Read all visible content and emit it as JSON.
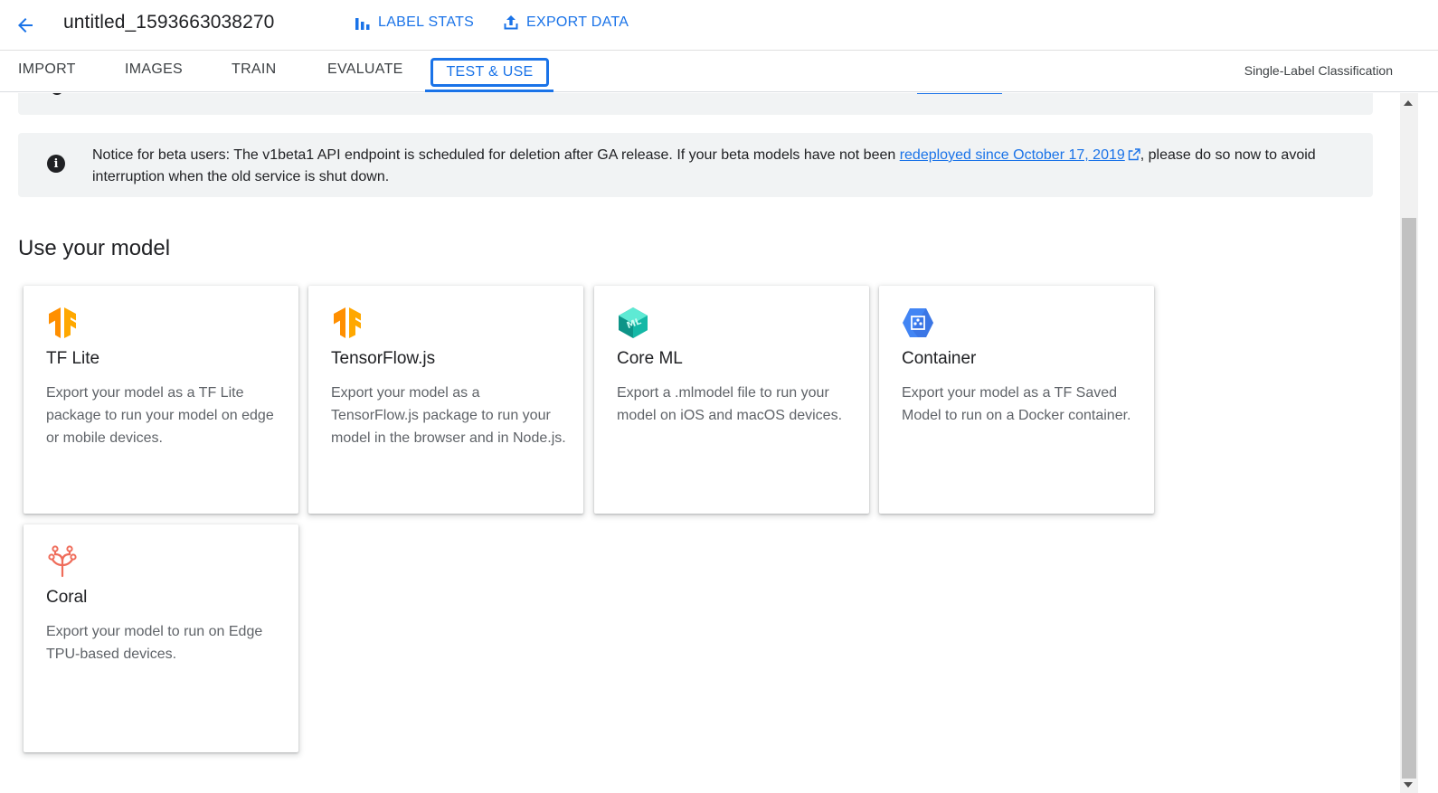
{
  "header": {
    "title": "untitled_1593663038270",
    "label_stats": "LABEL STATS",
    "export_data": "EXPORT DATA"
  },
  "tabs": [
    {
      "label": "IMPORT"
    },
    {
      "label": "IMAGES"
    },
    {
      "label": "TRAIN"
    },
    {
      "label": "EVALUATE"
    },
    {
      "label": "TEST & USE",
      "active": true
    }
  ],
  "model_type": "Single-Label Classification",
  "notice": {
    "text_before": "Notice for beta users: The v1beta1 API endpoint is scheduled for deletion after GA release. If your beta models have not been ",
    "link": "redeployed since October 17, 2019",
    "text_after": ", please do so now to avoid interruption when the old service is shut down."
  },
  "section_title": "Use your model",
  "cards": [
    {
      "title": "TF Lite",
      "description": "Export your model as a TF Lite package to run your model on edge or mobile devices.",
      "icon": "tensorflow-icon"
    },
    {
      "title": "TensorFlow.js",
      "description": "Export your model as a TensorFlow.js package to run your model in the browser and in Node.js.",
      "icon": "tensorflow-icon"
    },
    {
      "title": "Core ML",
      "description": "Export a .mlmodel file to run your model on iOS and macOS devices.",
      "icon": "coreml-icon"
    },
    {
      "title": "Container",
      "description": "Export your model as a TF Saved Model to run on a Docker container.",
      "icon": "container-icon"
    },
    {
      "title": "Coral",
      "description": "Export your model to run on Edge TPU-based devices.",
      "icon": "coral-icon"
    }
  ],
  "colors": {
    "accent": "#1a73e8",
    "tf_orange": "#ff8f00",
    "coreml_teal": "#14b8a6",
    "container_blue": "#4285f4",
    "coral_red": "#ef6c5a"
  }
}
